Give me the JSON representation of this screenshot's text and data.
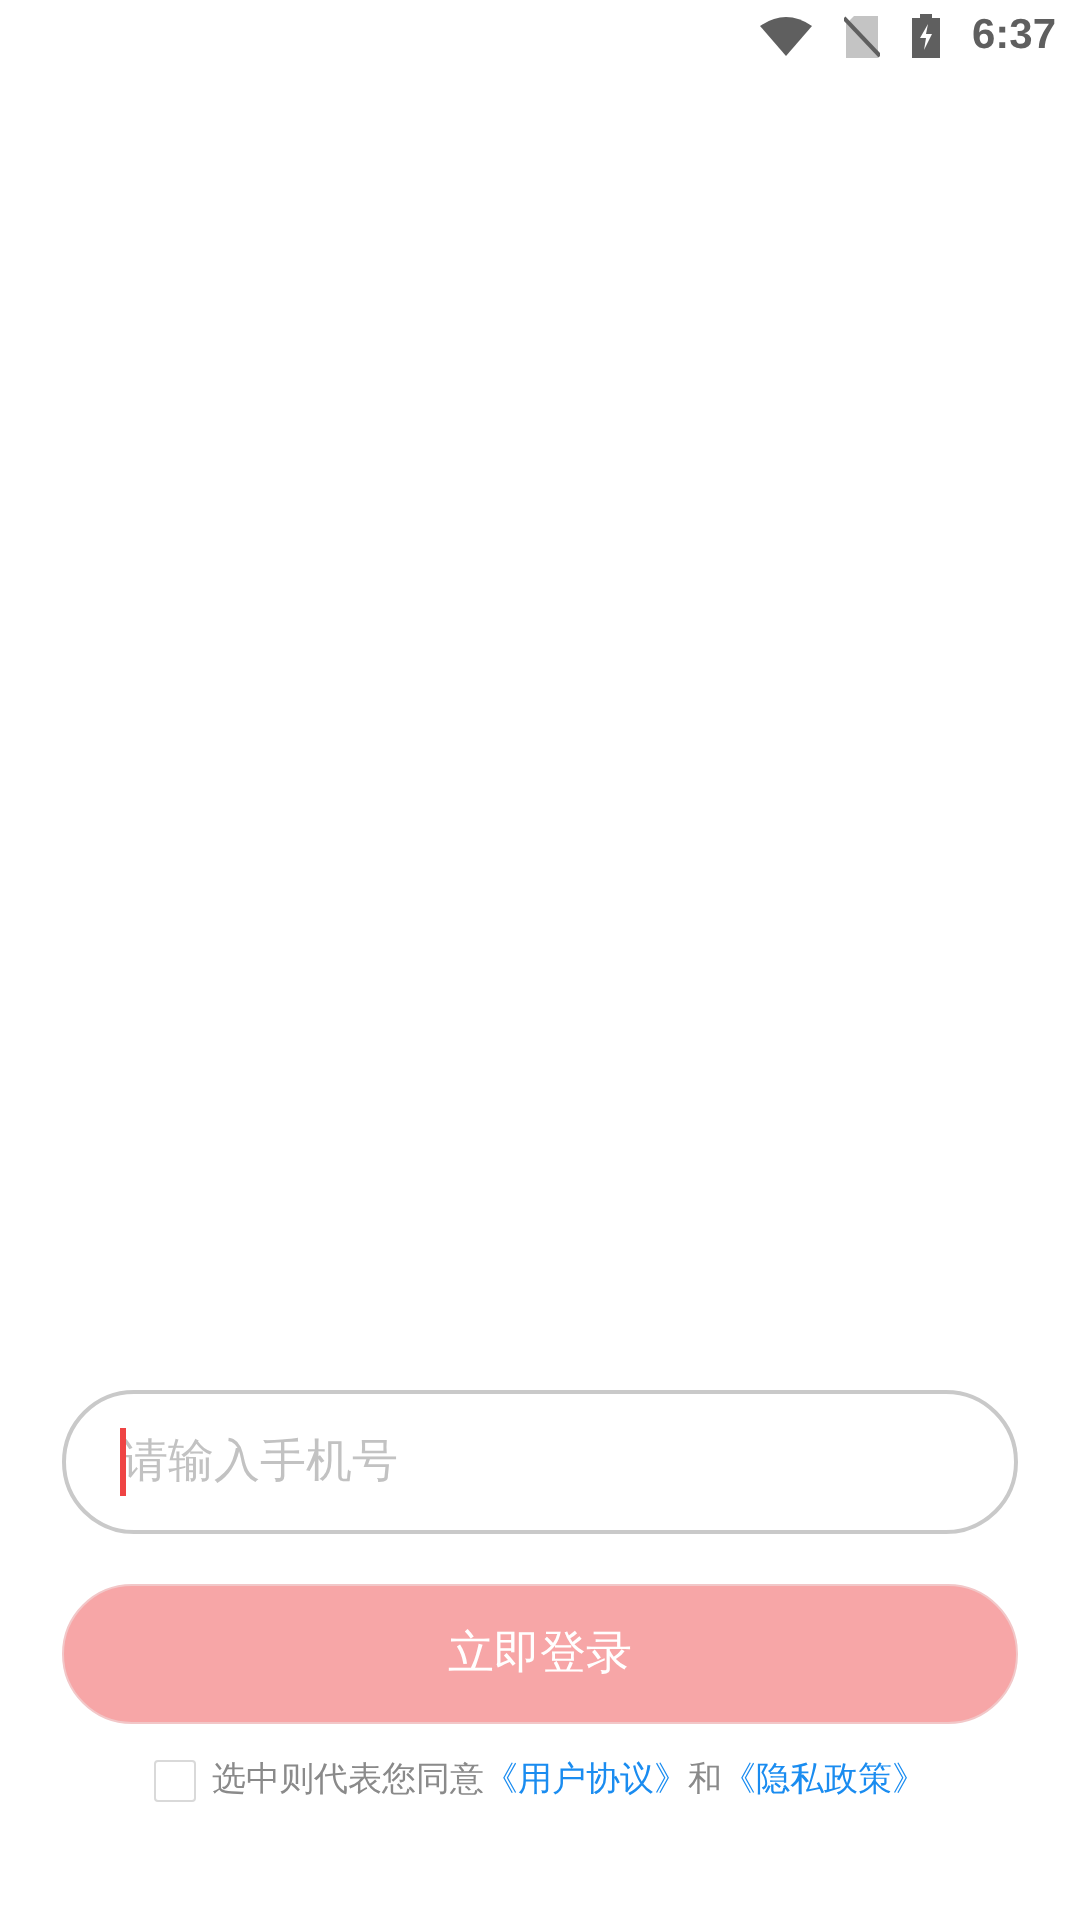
{
  "status_bar": {
    "time": "6:37"
  },
  "phone_field": {
    "placeholder": "请输入手机号",
    "focused": true
  },
  "login_button": {
    "label": "立即登录"
  },
  "agreement": {
    "checked": false,
    "prefix": "选中则代表您同意",
    "user_agreement_link": "《用户协议》",
    "joiner": "和",
    "privacy_policy_link": "《隐私政策》"
  }
}
